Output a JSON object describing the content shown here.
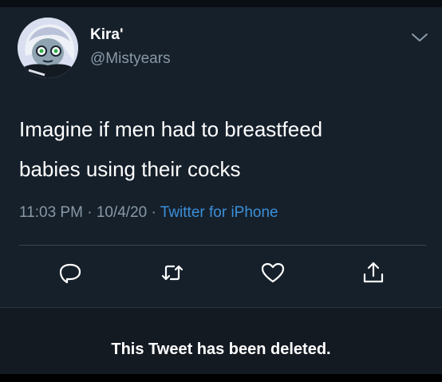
{
  "tweet": {
    "display_name": "Kira'",
    "handle": "@Mistyears",
    "text_line1": "Imagine if men had to breastfeed",
    "text_line2": "babies using their cocks",
    "time": "11:03 PM",
    "date": "10/4/20",
    "separator": "·",
    "source": "Twitter for iPhone",
    "avatar_icon": "cartoon-character-avatar",
    "menu_icon": "chevron-down-icon"
  },
  "actions": [
    {
      "name": "reply",
      "icon": "reply-icon"
    },
    {
      "name": "retweet",
      "icon": "retweet-icon"
    },
    {
      "name": "like",
      "icon": "heart-icon"
    },
    {
      "name": "share",
      "icon": "share-icon"
    }
  ],
  "notice": {
    "text": "This Tweet has been deleted."
  },
  "colors": {
    "background": "#17202b",
    "text": "#ffffff",
    "secondary_text": "#8899a6",
    "link": "#3a8fd9",
    "divider": "#38444d"
  }
}
